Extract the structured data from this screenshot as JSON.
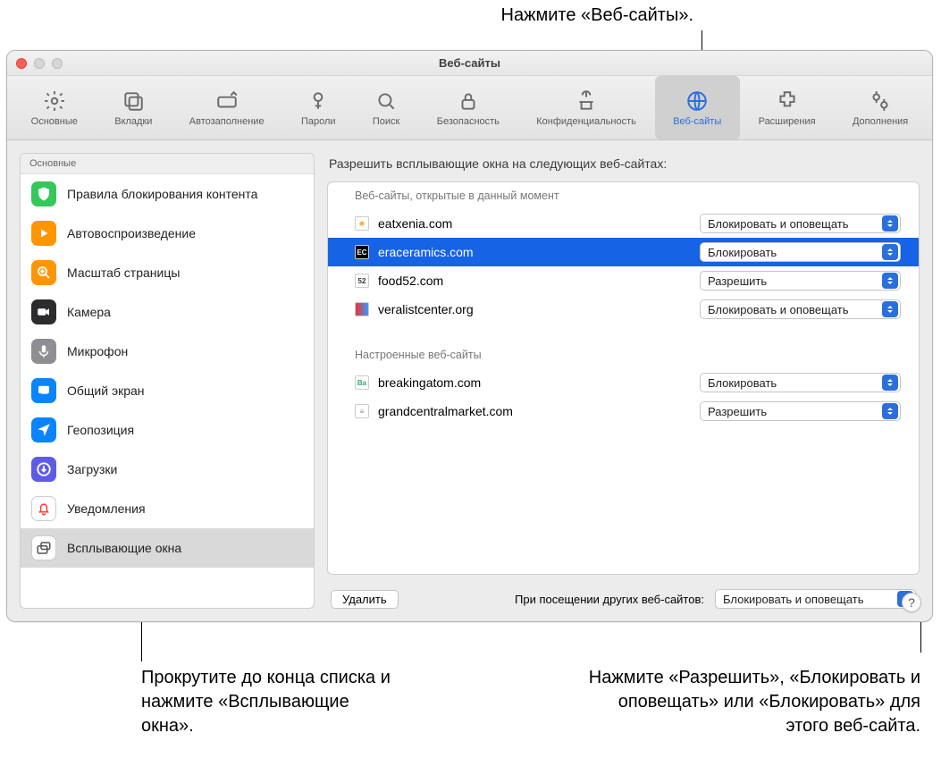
{
  "callouts": {
    "top": "Нажмите «Веб-сайты».",
    "bottom_left": "Прокрутите до конца списка и нажмите «Всплывающие окна».",
    "bottom_right": "Нажмите «Разрешить», «Блокировать и оповещать» или «Блокировать» для этого веб-сайта."
  },
  "window": {
    "title": "Веб-сайты"
  },
  "toolbar": [
    {
      "id": "general",
      "label": "Основные"
    },
    {
      "id": "tabs",
      "label": "Вкладки"
    },
    {
      "id": "autofill",
      "label": "Автозаполнение"
    },
    {
      "id": "passwords",
      "label": "Пароли"
    },
    {
      "id": "search",
      "label": "Поиск"
    },
    {
      "id": "security",
      "label": "Безопасность"
    },
    {
      "id": "privacy",
      "label": "Конфиденциальность"
    },
    {
      "id": "websites",
      "label": "Веб-сайты"
    },
    {
      "id": "extensions",
      "label": "Расширения"
    },
    {
      "id": "advanced",
      "label": "Дополнения"
    }
  ],
  "sidebar": {
    "header": "Основные",
    "items": [
      {
        "id": "content-blockers",
        "label": "Правила блокирования контента",
        "color": "#34c759"
      },
      {
        "id": "autoplay",
        "label": "Автовоспроизведение",
        "color": "#ff9500"
      },
      {
        "id": "page-zoom",
        "label": "Масштаб страницы",
        "color": "#ff9500"
      },
      {
        "id": "camera",
        "label": "Камера",
        "color": "#2c2c2e"
      },
      {
        "id": "microphone",
        "label": "Микрофон",
        "color": "#8e8e93"
      },
      {
        "id": "screen-share",
        "label": "Общий экран",
        "color": "#0a84ff"
      },
      {
        "id": "location",
        "label": "Геопозиция",
        "color": "#0a84ff"
      },
      {
        "id": "downloads",
        "label": "Загрузки",
        "color": "#5e5ce6"
      },
      {
        "id": "notifications",
        "label": "Уведомления",
        "color": "#ffffff"
      },
      {
        "id": "popups",
        "label": "Всплывающие окна",
        "color": "#ffffff"
      }
    ],
    "selected": "popups"
  },
  "main": {
    "heading": "Разрешить всплывающие окна на следующих веб-сайтах:",
    "section_open": "Веб-сайты, открытые в данный момент",
    "section_conf": "Настроенные веб-сайты",
    "open_sites": [
      {
        "domain": "eatxenia.com",
        "option": "Блокировать и оповещать",
        "favicon_bg": "#fff",
        "favicon_text": "✳",
        "favicon_color": "#ff9500"
      },
      {
        "domain": "eraceramics.com",
        "option": "Блокировать",
        "favicon_bg": "#000",
        "favicon_text": "EC",
        "favicon_color": "#fff",
        "selected": true
      },
      {
        "domain": "food52.com",
        "option": "Разрешить",
        "favicon_bg": "#fff",
        "favicon_text": "52",
        "favicon_color": "#333"
      },
      {
        "domain": "veralistcenter.org",
        "option": "Блокировать и оповещать",
        "favicon_bg": "linear-gradient(90deg,#e33,#39f)",
        "favicon_text": "",
        "favicon_color": "#fff"
      }
    ],
    "conf_sites": [
      {
        "domain": "breakingatom.com",
        "option": "Блокировать",
        "favicon_bg": "#fff",
        "favicon_text": "Ba",
        "favicon_color": "#3a7"
      },
      {
        "domain": "grandcentralmarket.com",
        "option": "Разрешить",
        "favicon_bg": "#fff",
        "favicon_text": "≡",
        "favicon_color": "#888"
      }
    ],
    "remove_label": "Удалить",
    "other_label": "При посещении других веб-сайтов:",
    "other_option": "Блокировать и оповещать"
  },
  "help_glyph": "?"
}
